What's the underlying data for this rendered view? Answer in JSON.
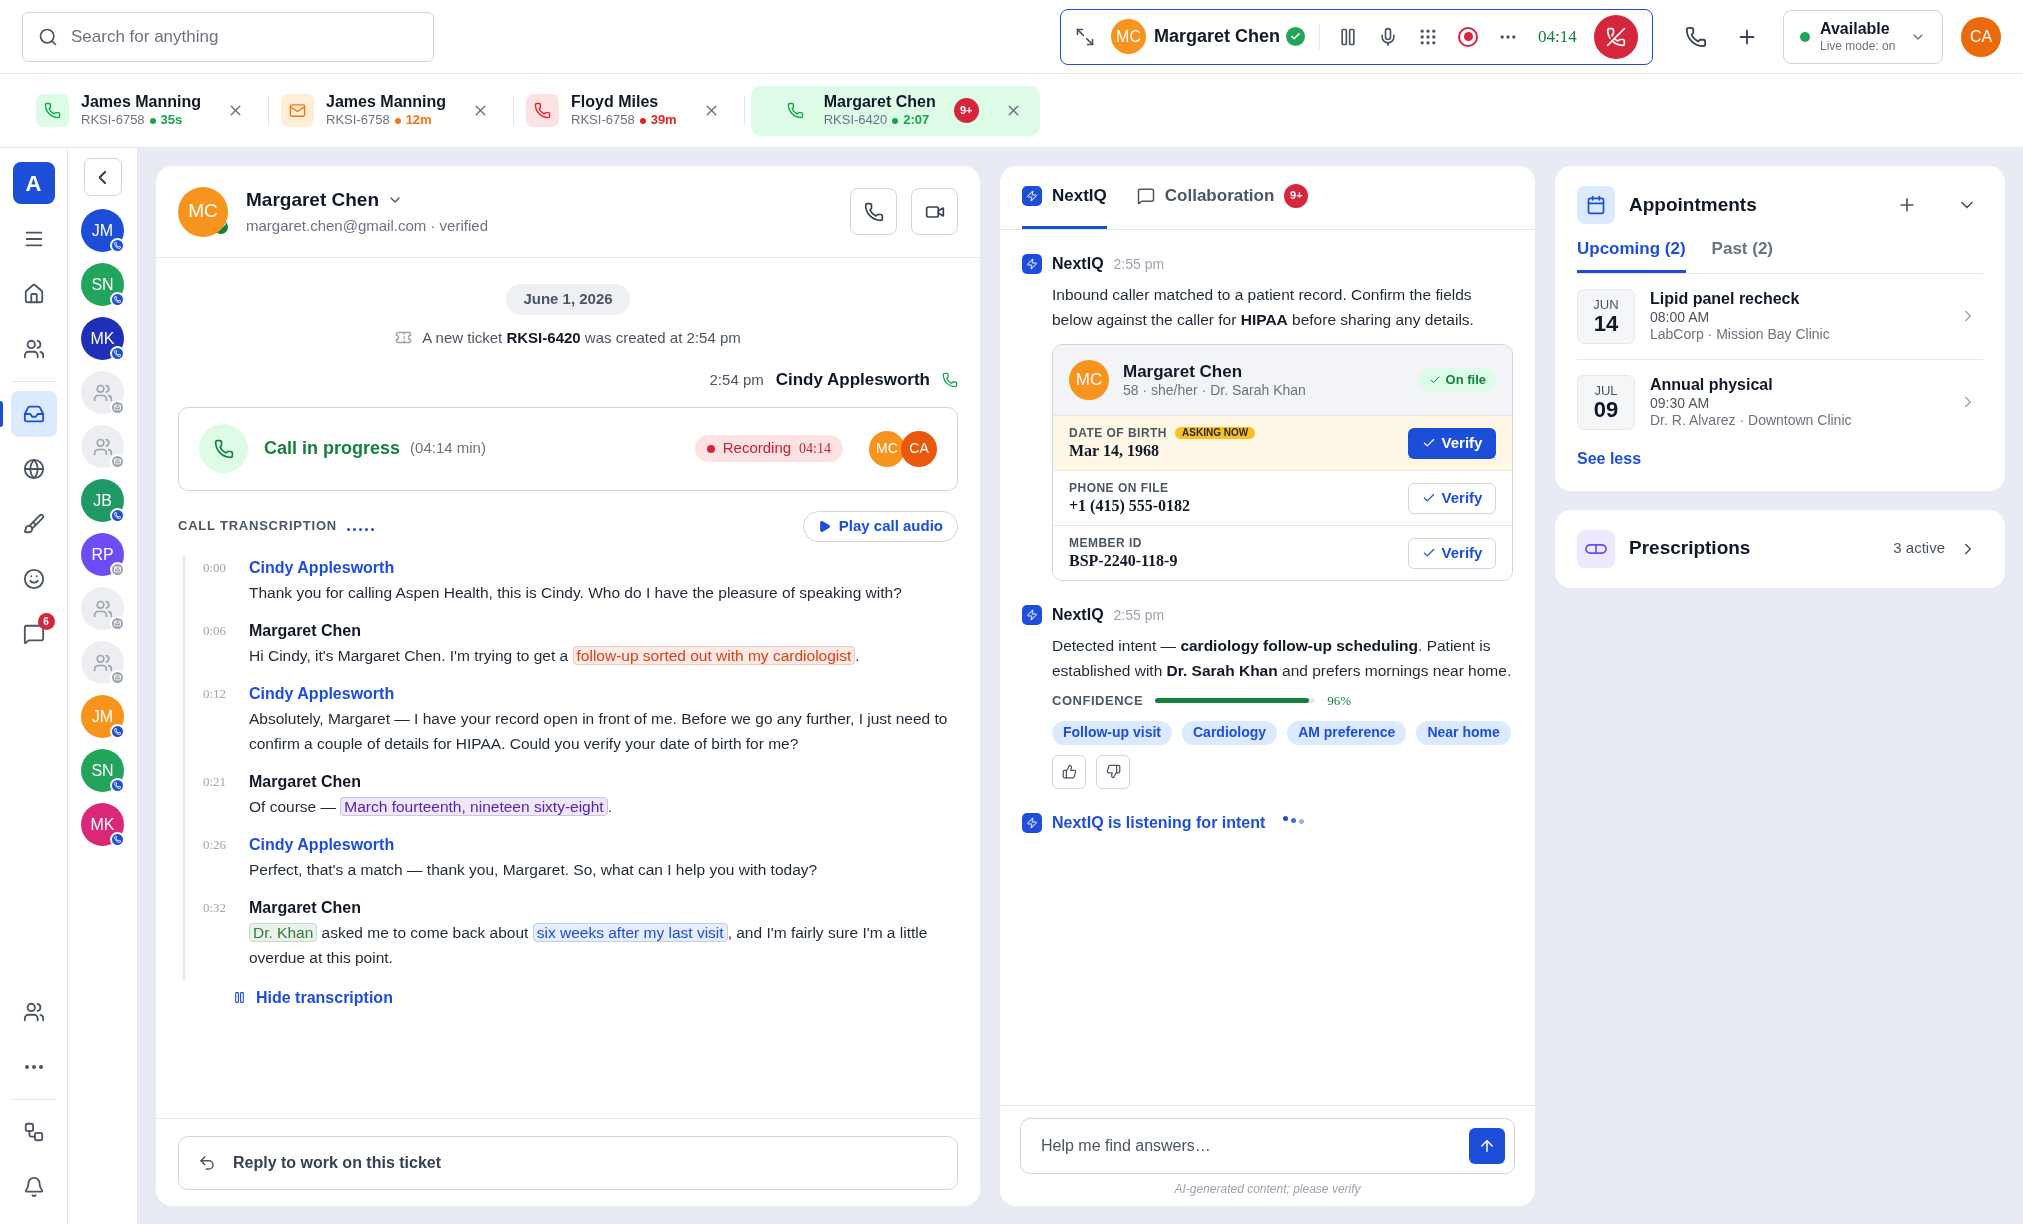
{
  "search": {
    "placeholder": "Search for anything"
  },
  "call_bar": {
    "initials": "MC",
    "name": "Margaret Chen",
    "verified": true,
    "timer": "04:14",
    "recording": true
  },
  "status": {
    "label": "Available",
    "sublabel": "Live mode: on",
    "online": true
  },
  "user_avatar": "CA",
  "conversation_tabs": [
    {
      "kind": "call",
      "name": "James Manning",
      "ticket": "RKSI-6758",
      "age": "35s",
      "color": "#16a34a",
      "selected": false
    },
    {
      "kind": "email",
      "name": "James Manning",
      "ticket": "RKSI-6758",
      "age": "12m",
      "color": "#f97316",
      "selected": false
    },
    {
      "kind": "missed",
      "name": "Floyd Miles",
      "ticket": "RKSI-6758",
      "age": "39m",
      "color": "#dc2626",
      "selected": false
    },
    {
      "kind": "call",
      "name": "Margaret Chen",
      "ticket": "RKSI-6420",
      "age": "2:07",
      "color": "#16a34a",
      "selected": true,
      "badge": "9+"
    }
  ],
  "nav": {
    "logo": "A",
    "items": [
      {
        "kind": "menu",
        "selected": false
      },
      {
        "kind": "home",
        "selected": false
      },
      {
        "kind": "people",
        "selected": false
      },
      {
        "kind": "inbox",
        "selected": true
      },
      {
        "kind": "globe",
        "selected": false
      },
      {
        "kind": "brush",
        "selected": false
      },
      {
        "kind": "smile",
        "selected": false
      },
      {
        "kind": "chat",
        "selected": false,
        "badge": "6"
      }
    ],
    "bottom_items": [
      {
        "kind": "people",
        "selected": false
      },
      {
        "kind": "more",
        "selected": false
      },
      {
        "kind": "flow",
        "selected": false
      },
      {
        "kind": "bell",
        "selected": false
      }
    ]
  },
  "contacts": [
    {
      "kind": "call",
      "initials": "JM",
      "color": "#1d4ed8"
    },
    {
      "kind": "call",
      "initials": "SN",
      "color": "#22a55a"
    },
    {
      "kind": "call",
      "initials": "MK",
      "color": "#1e2fb8"
    },
    {
      "kind": "email"
    },
    {
      "kind": "email"
    },
    {
      "kind": "call",
      "initials": "JB",
      "color": "#1f9a64"
    },
    {
      "kind": "email",
      "initials": "RP",
      "color": "#6d4cf5"
    },
    {
      "kind": "email"
    },
    {
      "kind": "email"
    },
    {
      "kind": "call",
      "initials": "JM",
      "color": "#f7941d"
    },
    {
      "kind": "call",
      "initials": "SN",
      "color": "#22a55a"
    },
    {
      "kind": "call",
      "initials": "MK",
      "color": "#db2777"
    }
  ],
  "conversation": {
    "initials": "MC",
    "name": "Margaret Chen",
    "verified": true,
    "subtitle": "margaret.chen@gmail.com · verified",
    "date": "June 1, 2026",
    "event": "A new ticket **RKSI-6420** was created at 2:54 pm",
    "call_time": "2:54 pm",
    "agent": "Cindy Applesworth",
    "call": {
      "title": "Call in progress",
      "duration": "(04:14 min)",
      "recording_label": "Recording",
      "recording_time": "04:14",
      "participants": [
        {
          "initials": "MC",
          "color": "#f7941d"
        },
        {
          "initials": "CA",
          "color": "#ea580c"
        }
      ]
    },
    "transcription_label": "CALL TRANSCRIPTION",
    "play_label": "Play call audio",
    "transcript": [
      {
        "time": "0:00",
        "kind": "agent",
        "speaker": "Cindy Applesworth",
        "parts": [
          {
            "kind": "plain",
            "text": "Thank you for calling Aspen Health, this is Cindy. Who do I have the pleasure of speaking with?"
          }
        ]
      },
      {
        "time": "0:06",
        "kind": "customer",
        "speaker": "Margaret Chen",
        "parts": [
          {
            "kind": "plain",
            "text": "Hi Cindy, it's Margaret Chen. I'm trying to get a "
          },
          {
            "kind": "highlight",
            "color": "#dc3d12",
            "text": "follow-up sorted out with my cardiologist"
          },
          {
            "kind": "plain",
            "text": "."
          }
        ]
      },
      {
        "time": "0:12",
        "kind": "agent",
        "speaker": "Cindy Applesworth",
        "parts": [
          {
            "kind": "plain",
            "text": "Absolutely, Margaret — I have your record open in front of me. Before we go any further, I just need to confirm a couple of details for HIPAA. Could you verify your date of birth for me?"
          }
        ]
      },
      {
        "time": "0:21",
        "kind": "customer",
        "speaker": "Margaret Chen",
        "parts": [
          {
            "kind": "plain",
            "text": "Of course — "
          },
          {
            "kind": "highlight",
            "color": "#5b21b6",
            "text": "March fourteenth, nineteen sixty-eight"
          },
          {
            "kind": "plain",
            "text": "."
          }
        ]
      },
      {
        "time": "0:26",
        "kind": "agent",
        "speaker": "Cindy Applesworth",
        "parts": [
          {
            "kind": "plain",
            "text": "Perfect, that's a match — thank you, Margaret. So, what can I help you with today?"
          }
        ]
      },
      {
        "time": "0:32",
        "kind": "customer",
        "speaker": "Margaret Chen",
        "parts": [
          {
            "kind": "highlight",
            "color": "#2f7d3a",
            "text": "Dr. Khan"
          },
          {
            "kind": "plain",
            "text": " asked me to come back about "
          },
          {
            "kind": "highlight",
            "color": "#1d4ed8",
            "text": "six weeks after my last visit"
          },
          {
            "kind": "plain",
            "text": ", and I'm fairly sure I'm a little overdue at this point."
          }
        ]
      }
    ],
    "hide_label": "Hide transcription",
    "reply_placeholder": "Reply to work on this ticket"
  },
  "assistant": {
    "tabs": [
      {
        "label": "NextIQ",
        "kind": "bolt",
        "selected": true
      },
      {
        "label": "Collaboration",
        "kind": "chat",
        "selected": false,
        "badge": "9+"
      }
    ],
    "messages": [
      {
        "kind": "record",
        "author": "NextIQ",
        "time": "2:55 pm",
        "text": "Inbound caller matched to a patient record. Confirm the fields below against the caller for **HIPAA** before sharing any details.",
        "patient": {
          "initials": "MC",
          "name": "Margaret Chen",
          "details": "58 · she/her · Dr. Sarah Khan",
          "status": "On file"
        },
        "fields": [
          {
            "label": "DATE OF BIRTH",
            "value": "Mar 14, 1968",
            "active": true,
            "badge": "ASKING NOW",
            "action": "Verify"
          },
          {
            "label": "PHONE ON FILE",
            "value": "+1 (415) 555-0182",
            "active": false,
            "action": "Verify"
          },
          {
            "label": "MEMBER ID",
            "value": "BSP-2240-118-9",
            "active": false,
            "action": "Verify"
          }
        ]
      },
      {
        "kind": "intent",
        "author": "NextIQ",
        "time": "2:55 pm",
        "text": "Detected intent — **cardiology follow-up scheduling**. Patient is established with **Dr. Sarah Khan** and prefers mornings near home.",
        "confidence_label": "CONFIDENCE",
        "level": 0.96,
        "reading": "96%",
        "tags": [
          "Follow-up visit",
          "Cardiology",
          "AM preference",
          "Near home"
        ]
      }
    ],
    "listening": "NextIQ is listening for intent",
    "input_placeholder": "Help me find answers…",
    "disclaimer": "AI-generated content; please verify"
  },
  "appointments": {
    "title": "Appointments",
    "tabs": [
      {
        "label": "Upcoming (2)",
        "selected": true
      },
      {
        "label": "Past (2)",
        "selected": false
      }
    ],
    "items": [
      {
        "month": "JUN",
        "day": "14",
        "title": "Lipid panel recheck",
        "time": "08:00 AM",
        "place": "LabCorp · Mission Bay Clinic"
      },
      {
        "month": "JUL",
        "day": "09",
        "title": "Annual physical",
        "time": "09:30 AM",
        "place": "Dr. R. Alvarez · Downtown Clinic"
      }
    ],
    "toggle_label": "See less"
  },
  "prescriptions": {
    "title": "Prescriptions",
    "count": "3 active"
  }
}
